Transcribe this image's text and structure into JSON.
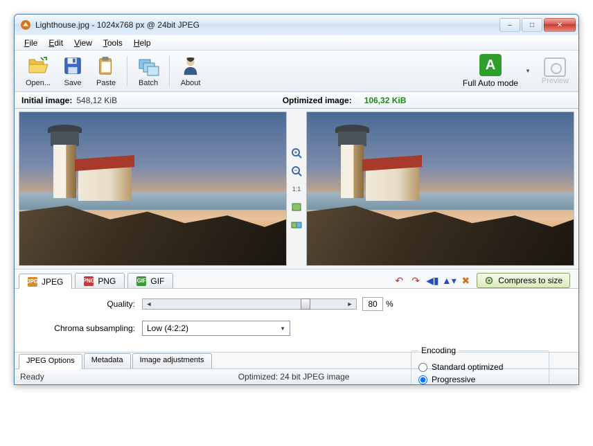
{
  "window": {
    "title": "Lighthouse.jpg - 1024x768 px @ 24bit JPEG",
    "minimize": "–",
    "maximize": "□",
    "close": "✕"
  },
  "menu": {
    "file": "File",
    "edit": "Edit",
    "view": "View",
    "tools": "Tools",
    "help": "Help"
  },
  "toolbar": {
    "open": "Open...",
    "save": "Save",
    "paste": "Paste",
    "batch": "Batch",
    "about": "About",
    "fullauto": "Full Auto mode",
    "fullauto_letter": "A",
    "preview": "Preview"
  },
  "sizes": {
    "initial_label": "Initial image:",
    "initial_value": "548,12 KiB",
    "optimized_label": "Optimized image:",
    "optimized_value": "106,32 KiB"
  },
  "midtools": {
    "zoom_in": "🔍",
    "zoom_out": "🔍",
    "fit": "1:1",
    "fit_window": "▣",
    "both": "▤"
  },
  "format_tabs": {
    "jpeg": "JPEG",
    "png": "PNG",
    "gif": "GIF"
  },
  "actions": {
    "compress": "Compress to size"
  },
  "options": {
    "quality_label": "Quality:",
    "quality_value": "80",
    "quality_pct": "%",
    "chroma_label": "Chroma subsampling:",
    "chroma_value": "Low (4:2:2)",
    "encoding_legend": "Encoding",
    "encoding_standard": "Standard optimized",
    "encoding_progressive": "Progressive"
  },
  "bottom_tabs": {
    "jpeg_options": "JPEG Options",
    "metadata": "Metadata",
    "image_adjustments": "Image adjustments"
  },
  "status": {
    "ready": "Ready",
    "optimized": "Optimized: 24 bit JPEG image"
  }
}
